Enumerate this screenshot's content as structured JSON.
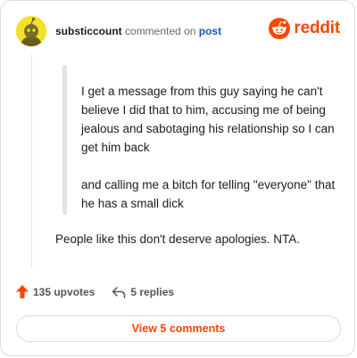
{
  "comment": {
    "username": "substiccount",
    "action_text": "commented on",
    "target_text": "post",
    "quote_paragraphs": [
      "I get a message from this guy saying he can't believe I did that to him, accusing me of being jealous and sabotaging his relationship so I can get him back",
      "and calling me a bitch for telling \"everyone\" that he has a small dick"
    ],
    "body": "People like this don't deserve apologies. NTA.",
    "upvotes_label": "135 upvotes",
    "replies_label": "5 replies",
    "view_comments_label": "View 5 comments"
  },
  "brand": {
    "wordmark": "reddit",
    "accent_color": "#ff4500",
    "avatar_color": "#f2e12a"
  },
  "icons": {
    "avatar": "snoo-avatar",
    "logo": "reddit-snoo-icon",
    "upvote": "upvote-arrow-icon",
    "reply": "reply-arrow-icon"
  }
}
